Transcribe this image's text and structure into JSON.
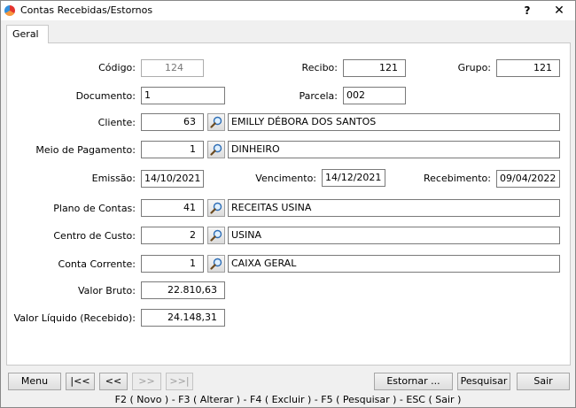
{
  "window": {
    "title": "Contas Recebidas/Estornos",
    "help": "?",
    "close": "✕"
  },
  "tabs": [
    {
      "label": "Geral"
    }
  ],
  "form": {
    "codigo": {
      "label": "Código:",
      "value": "124"
    },
    "recibo": {
      "label": "Recibo:",
      "value": "121"
    },
    "grupo": {
      "label": "Grupo:",
      "value": "121"
    },
    "documento": {
      "label": "Documento:",
      "value": "1"
    },
    "parcela": {
      "label": "Parcela:",
      "value": "002"
    },
    "cliente": {
      "label": "Cliente:",
      "code": "63",
      "name": "EMILLY DÉBORA DOS SANTOS"
    },
    "meio_pagamento": {
      "label": "Meio de Pagamento:",
      "code": "1",
      "name": "DINHEIRO"
    },
    "emissao": {
      "label": "Emissão:",
      "value": "14/10/2021"
    },
    "vencimento": {
      "label": "Vencimento:",
      "value": "14/12/2021"
    },
    "recebimento": {
      "label": "Recebimento:",
      "value": "09/04/2022"
    },
    "plano_contas": {
      "label": "Plano de Contas:",
      "code": "41",
      "name": "RECEITAS USINA"
    },
    "centro_custo": {
      "label": "Centro de Custo:",
      "code": "2",
      "name": "USINA"
    },
    "conta_corrente": {
      "label": "Conta Corrente:",
      "code": "1",
      "name": "CAIXA GERAL"
    },
    "valor_bruto": {
      "label": "Valor Bruto:",
      "value": "22.810,63"
    },
    "valor_liquido": {
      "label": "Valor Líquido (Recebido):",
      "value": "24.148,31"
    }
  },
  "buttons": {
    "menu": "Menu",
    "first": "|<<",
    "prev": "<<",
    "next": ">>",
    "last": ">>|",
    "estornar": "Estornar ...",
    "pesquisar": "Pesquisar",
    "sair": "Sair"
  },
  "status_bar": "F2 ( Novo )  -  F3 ( Alterar )  -  F4 ( Excluir )  -  F5 ( Pesquisar )  -  ESC ( Sair )",
  "icons": {
    "search": "magnifier-icon",
    "app": "app-logo-icon"
  }
}
